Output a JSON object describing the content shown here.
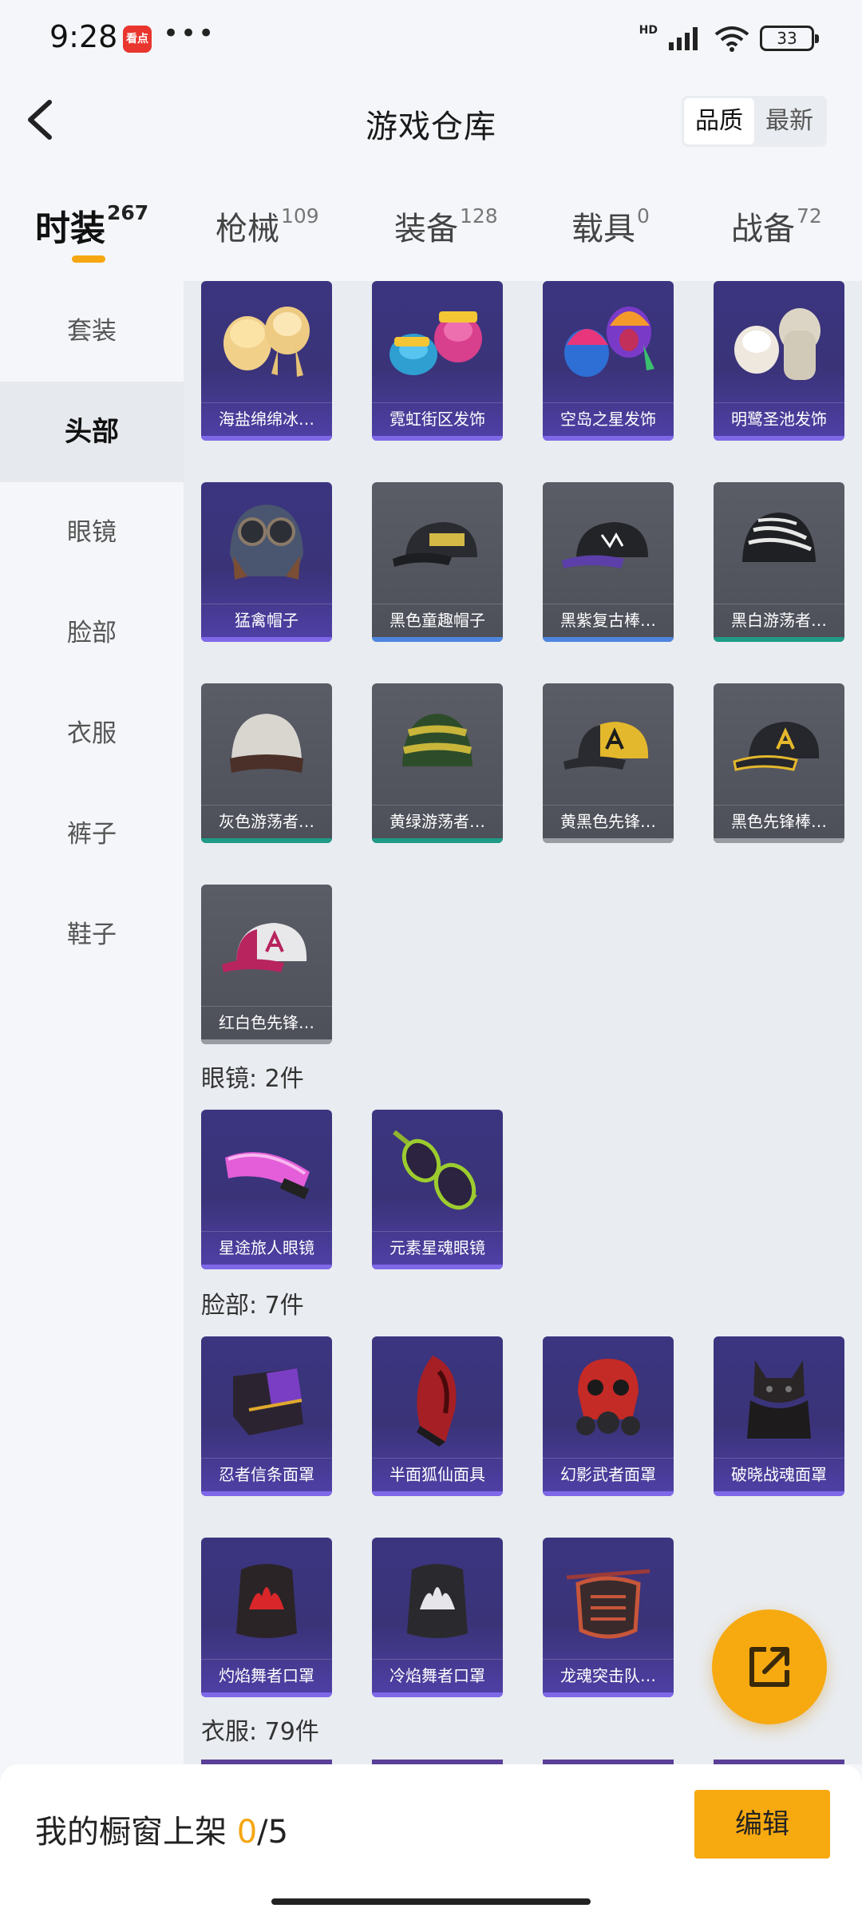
{
  "status_bar": {
    "time": "9:28",
    "app_badge": "看点",
    "dots": "•••",
    "network": "HD",
    "battery": "33"
  },
  "header": {
    "title": "游戏仓库",
    "sort_options": [
      "品质",
      "最新"
    ]
  },
  "tabs": [
    {
      "label": "时装",
      "count": "267"
    },
    {
      "label": "枪械",
      "count": "109"
    },
    {
      "label": "装备",
      "count": "128"
    },
    {
      "label": "载具",
      "count": "0"
    },
    {
      "label": "战备",
      "count": "72"
    }
  ],
  "sidebar": [
    "套装",
    "头部",
    "眼镜",
    "脸部",
    "衣服",
    "裤子",
    "鞋子"
  ],
  "items": [
    {
      "name": "海盐绵绵冰…",
      "rarity": "purple",
      "icon": "blonde-hair-icon"
    },
    {
      "name": "霓虹街区发饰",
      "rarity": "purple",
      "icon": "neon-hair-icon"
    },
    {
      "name": "空岛之星发饰",
      "rarity": "purple",
      "icon": "colorful-hair-icon"
    },
    {
      "name": "明鹭圣池发饰",
      "rarity": "purple",
      "icon": "white-hair-icon"
    },
    {
      "name": "猛禽帽子",
      "rarity": "purple",
      "icon": "aviator-cap-icon"
    },
    {
      "name": "黑色童趣帽子",
      "rarity": "blue",
      "icon": "black-cap-icon"
    },
    {
      "name": "黑紫复古棒…",
      "rarity": "blue",
      "icon": "black-purple-cap-icon"
    },
    {
      "name": "黑白游荡者…",
      "rarity": "green",
      "icon": "zebra-beanie-icon"
    },
    {
      "name": "灰色游荡者…",
      "rarity": "green",
      "icon": "gray-beanie-icon"
    },
    {
      "name": "黄绿游荡者…",
      "rarity": "green",
      "icon": "striped-beanie-icon"
    },
    {
      "name": "黄黑色先锋…",
      "rarity": "gray",
      "icon": "yellow-cap-icon"
    },
    {
      "name": "黑色先锋棒…",
      "rarity": "gray",
      "icon": "black-yellow-cap-icon"
    },
    {
      "name": "红白色先锋…",
      "rarity": "gray",
      "icon": "red-white-cap-icon"
    },
    {
      "name": "星途旅人眼镜",
      "rarity": "purple",
      "icon": "pink-goggles-icon"
    },
    {
      "name": "元素星魂眼镜",
      "rarity": "purple",
      "icon": "green-sunglasses-icon"
    },
    {
      "name": "忍者信条面罩",
      "rarity": "purple",
      "icon": "ninja-mask-icon"
    },
    {
      "name": "半面狐仙面具",
      "rarity": "purple",
      "icon": "fox-mask-icon"
    },
    {
      "name": "幻影武者面罩",
      "rarity": "purple",
      "icon": "samurai-mask-icon"
    },
    {
      "name": "破晓战魂面罩",
      "rarity": "purple",
      "icon": "wolf-mask-icon"
    },
    {
      "name": "灼焰舞者口罩",
      "rarity": "purple",
      "icon": "flame-mask-icon"
    },
    {
      "name": "冷焰舞者口罩",
      "rarity": "purple",
      "icon": "white-flame-mask-icon"
    },
    {
      "name": "龙魂突击队…",
      "rarity": "purple",
      "icon": "dragon-mask-icon"
    }
  ],
  "sections": {
    "glasses": "眼镜: 2件",
    "face": "脸部: 7件",
    "clothes": "衣服: 79件"
  },
  "bottom": {
    "label": "我的橱窗上架 ",
    "current": "0",
    "total": "/5",
    "edit_button": "编辑"
  },
  "colors": {
    "accent": "#f7a910",
    "rarity_purple": "#7f68e8",
    "rarity_blue": "#4d86e0",
    "rarity_green": "#1f9b86",
    "rarity_gray": "#9a9ca4"
  }
}
